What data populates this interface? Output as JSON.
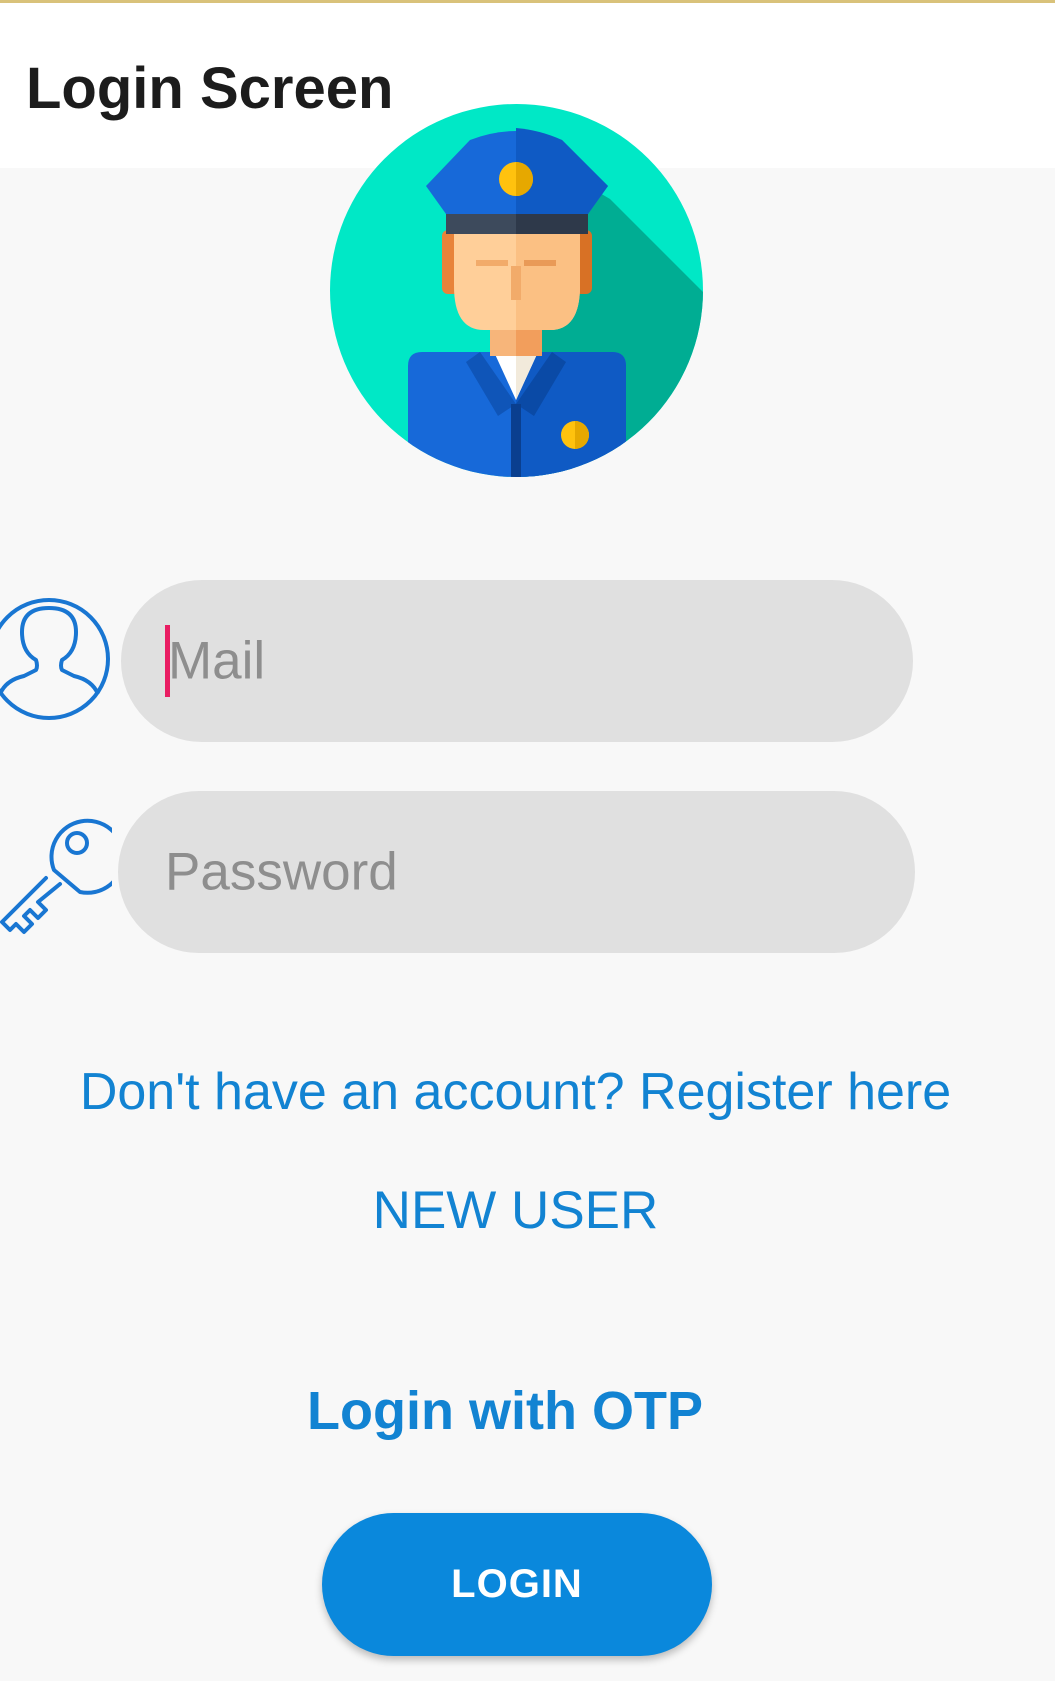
{
  "app_bar": {
    "title": "Login Screen"
  },
  "avatar": {
    "icon": "police-officer-avatar-icon"
  },
  "form": {
    "mail": {
      "icon": "user-icon",
      "placeholder": "Mail",
      "value": ""
    },
    "password": {
      "icon": "key-icon",
      "placeholder": "Password",
      "value": ""
    }
  },
  "links": {
    "register": "Don't have an account? Register here",
    "new_user": "NEW USER",
    "otp": "Login with OTP"
  },
  "buttons": {
    "login": "LOGIN"
  },
  "colors": {
    "accent_blue": "#1283d2",
    "button_blue": "#0a88dc",
    "field_bg": "#e0e0e0",
    "caret": "#e91e63",
    "avatar_bg": "#00e8c6"
  }
}
